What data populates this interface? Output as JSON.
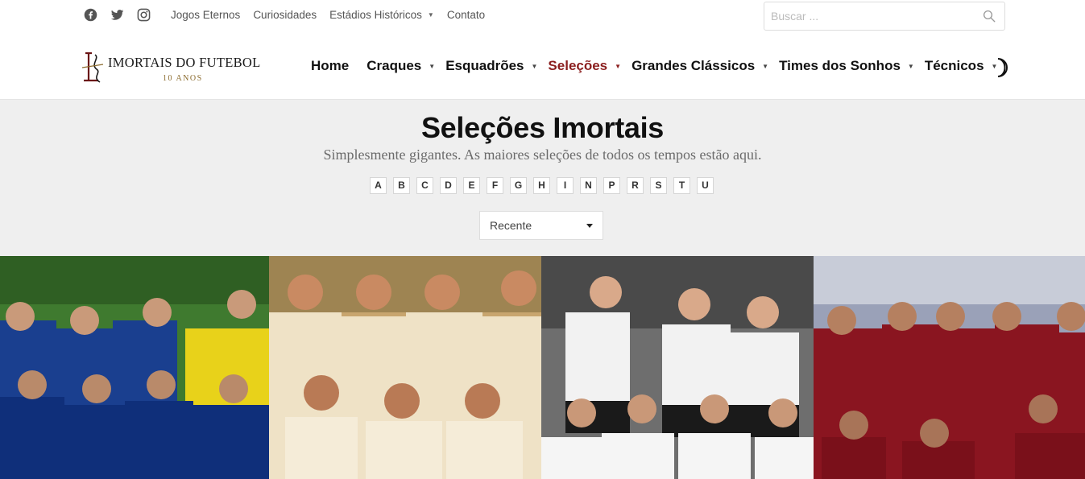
{
  "topbar": {
    "social": [
      {
        "icon": "facebook-icon"
      },
      {
        "icon": "twitter-icon"
      },
      {
        "icon": "instagram-icon"
      }
    ],
    "links": [
      {
        "label": "Jogos Eternos",
        "has_dropdown": false
      },
      {
        "label": "Curiosidades",
        "has_dropdown": false
      },
      {
        "label": "Estádios Históricos",
        "has_dropdown": true
      },
      {
        "label": "Contato",
        "has_dropdown": false
      }
    ],
    "search": {
      "placeholder": "Buscar ...",
      "value": ""
    }
  },
  "brand": {
    "name": "IMORTAIS DO FUTEBOL",
    "subtitle": "10 ANOS",
    "name_color": "#1a1a1a",
    "subtitle_color": "#8b6b2e"
  },
  "nav": {
    "items": [
      {
        "label": "Home",
        "has_dropdown": false,
        "active": false
      },
      {
        "label": "Craques",
        "has_dropdown": true,
        "active": false
      },
      {
        "label": "Esquadrões",
        "has_dropdown": true,
        "active": false
      },
      {
        "label": "Seleções",
        "has_dropdown": true,
        "active": true
      },
      {
        "label": "Grandes Clássicos",
        "has_dropdown": true,
        "active": false
      },
      {
        "label": "Times dos Sonhos",
        "has_dropdown": true,
        "active": false
      },
      {
        "label": "Técnicos",
        "has_dropdown": true,
        "active": false
      }
    ],
    "active_color": "#8b1e1e",
    "theme_toggle_icon": "moon-icon"
  },
  "hero": {
    "title": "Seleções Imortais",
    "tagline": "Simplesmente gigantes. As maiores seleções de todos os tempos estão aqui.",
    "letters": [
      "A",
      "B",
      "C",
      "D",
      "E",
      "F",
      "G",
      "H",
      "I",
      "N",
      "P",
      "R",
      "S",
      "T",
      "U"
    ],
    "sort": {
      "selected": "Recente"
    }
  },
  "cards": [
    {
      "image": "italy-team-photo"
    },
    {
      "image": "brazil-vintage-team-photo"
    },
    {
      "image": "west-germany-team-photo"
    },
    {
      "image": "portugal-team-photo"
    }
  ]
}
